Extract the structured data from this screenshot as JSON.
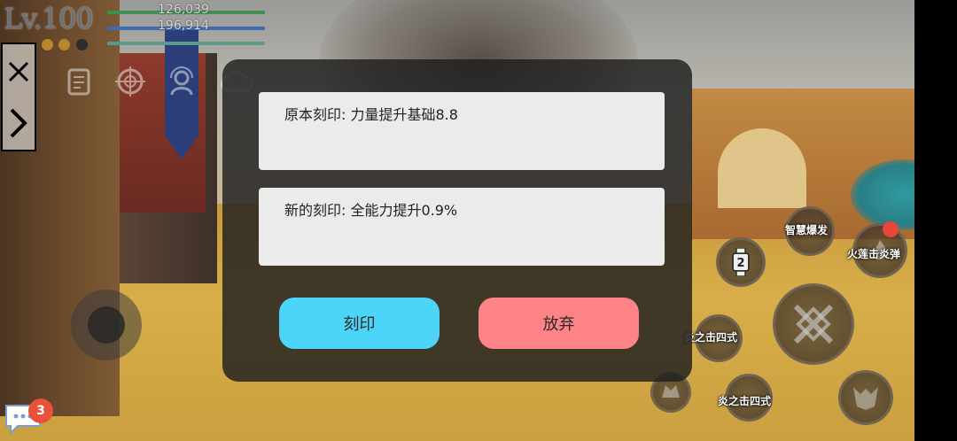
{
  "hud": {
    "level": "Lv.100",
    "hp_value": "126,039",
    "mp_value": "196,914",
    "colors": {
      "hp": "#3f8f52",
      "mp": "#3d6db0",
      "xp": "#5a9a88"
    },
    "orbs": [
      "#b8872c",
      "#b8872c",
      "#2d2d2d"
    ]
  },
  "side_panel": {
    "icons": [
      "close-icon",
      "chevron-right-icon"
    ]
  },
  "toolbar_icons": [
    "scroll-icon",
    "target-icon",
    "support-icon",
    "cloud-icon"
  ],
  "dialog": {
    "original_label": "原本刻印: 力量提升基础8.8",
    "new_label": "新的刻印: 全能力提升0.9%",
    "confirm_button": "刻印",
    "abandon_button": "放弃",
    "colors": {
      "confirm": "#4cd5f9",
      "abandon": "#fd8387"
    }
  },
  "skills": {
    "wisdom_burst": "智慧爆发",
    "fire_lotus": "火莲击炎弹",
    "flame_four_a": "炎之击四式",
    "flame_four_b": "炎之击四式",
    "watch_slot": "2"
  },
  "chat": {
    "unread_count": "3"
  }
}
